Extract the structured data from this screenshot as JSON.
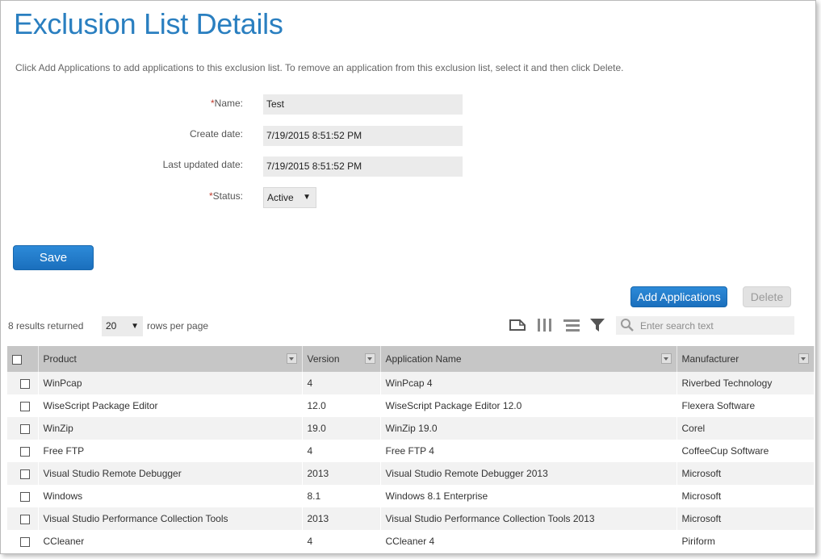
{
  "page": {
    "title": "Exclusion List Details",
    "instructions": "Click Add Applications to add applications to this exclusion list. To remove an application from this exclusion list, select it and then click Delete."
  },
  "form": {
    "name": {
      "required_mark": "*",
      "label": "Name:",
      "value": "Test"
    },
    "create_date": {
      "label": "Create date:",
      "value": "7/19/2015 8:51:52 PM"
    },
    "last_updated": {
      "label": "Last updated date:",
      "value": "7/19/2015 8:51:52 PM"
    },
    "status": {
      "required_mark": "*",
      "label": "Status:",
      "value": "Active",
      "caret": "▼"
    }
  },
  "buttons": {
    "save": "Save",
    "add_applications": "Add Applications",
    "delete": "Delete"
  },
  "grid_toolbar": {
    "results_text": "8 results returned",
    "rows_per_page_value": "20",
    "rows_caret": "▼",
    "rows_per_page_label": "rows per page",
    "icons": [
      "export-icon",
      "columns-icon",
      "group-icon",
      "filter-icon",
      "search-icon"
    ],
    "search_placeholder": "Enter search text"
  },
  "table": {
    "columns": [
      "Product",
      "Version",
      "Application Name",
      "Manufacturer"
    ],
    "rows": [
      {
        "product": "WinPcap",
        "version": "4",
        "app_name": "WinPcap 4",
        "manufacturer": "Riverbed Technology"
      },
      {
        "product": "WiseScript Package Editor",
        "version": "12.0",
        "app_name": "WiseScript Package Editor 12.0",
        "manufacturer": "Flexera Software"
      },
      {
        "product": "WinZip",
        "version": "19.0",
        "app_name": "WinZip 19.0",
        "manufacturer": "Corel"
      },
      {
        "product": "Free FTP",
        "version": "4",
        "app_name": "Free FTP 4",
        "manufacturer": "CoffeeCup Software"
      },
      {
        "product": "Visual Studio Remote Debugger",
        "version": "2013",
        "app_name": "Visual Studio Remote Debugger 2013",
        "manufacturer": "Microsoft"
      },
      {
        "product": "Windows",
        "version": "8.1",
        "app_name": "Windows 8.1 Enterprise",
        "manufacturer": "Microsoft"
      },
      {
        "product": "Visual Studio Performance Collection Tools",
        "version": "2013",
        "app_name": "Visual Studio Performance Collection Tools 2013",
        "manufacturer": "Microsoft"
      },
      {
        "product": "CCleaner",
        "version": "4",
        "app_name": "CCleaner 4",
        "manufacturer": "Piriform"
      }
    ]
  },
  "colors": {
    "title": "#2a7fc0",
    "primary_button": "#1f78c8",
    "header_bg": "#c6c6c6",
    "required_mark": "#c0392b"
  }
}
